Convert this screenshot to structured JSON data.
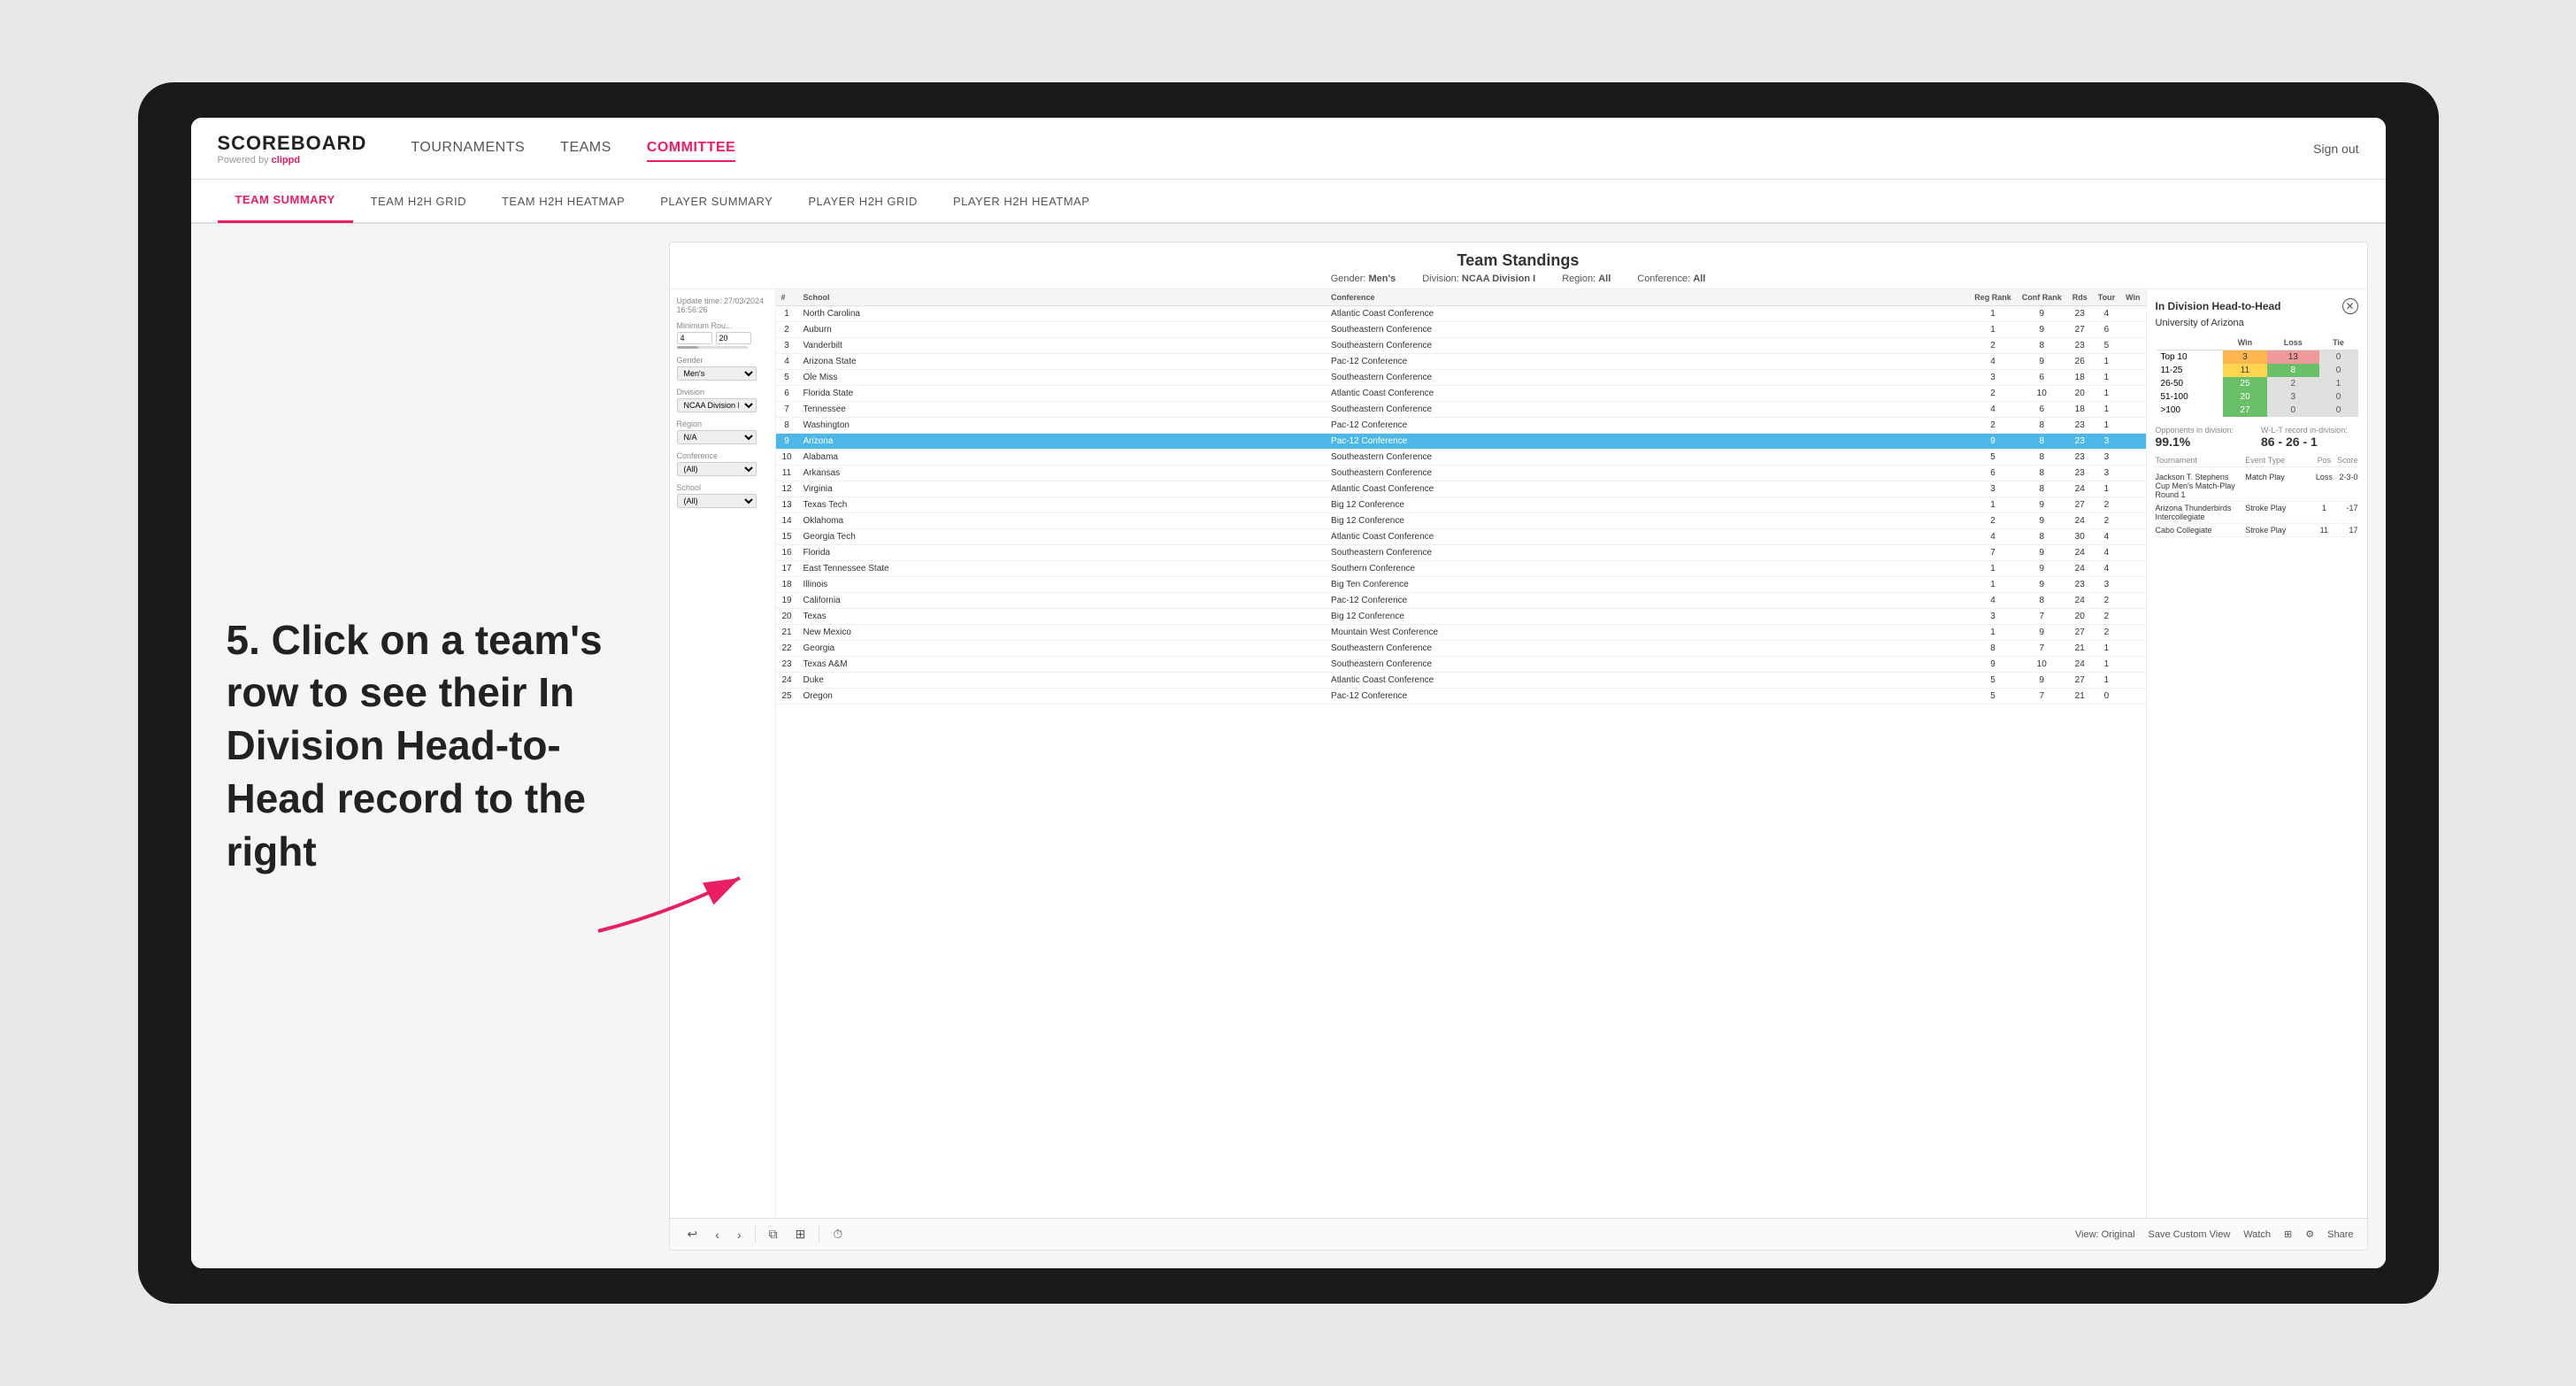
{
  "app": {
    "logo": "SCOREBOARD",
    "logo_sub": "Powered by clippd",
    "sign_out": "Sign out"
  },
  "nav": {
    "items": [
      {
        "label": "TOURNAMENTS",
        "active": false
      },
      {
        "label": "TEAMS",
        "active": false
      },
      {
        "label": "COMMITTEE",
        "active": true
      }
    ]
  },
  "sub_nav": {
    "items": [
      {
        "label": "TEAM SUMMARY",
        "active": true
      },
      {
        "label": "TEAM H2H GRID",
        "active": false
      },
      {
        "label": "TEAM H2H HEATMAP",
        "active": false
      },
      {
        "label": "PLAYER SUMMARY",
        "active": false
      },
      {
        "label": "PLAYER H2H GRID",
        "active": false
      },
      {
        "label": "PLAYER H2H HEATMAP",
        "active": false
      }
    ]
  },
  "annotation": {
    "text": "5. Click on a team's row to see their In Division Head-to-Head record to the right"
  },
  "dashboard": {
    "title": "Team Standings",
    "update_time": "Update time: 27/03/2024 16:56:26",
    "meta": {
      "gender_label": "Gender:",
      "gender_val": "Men's",
      "division_label": "Division:",
      "division_val": "NCAA Division I",
      "region_label": "Region:",
      "region_val": "All",
      "conference_label": "Conference:",
      "conference_val": "All"
    },
    "filters": {
      "min_rounds_label": "Minimum Rou...",
      "min_rounds_val1": "4",
      "min_rounds_val2": "20",
      "gender_label": "Gender",
      "gender_val": "Men's",
      "division_label": "Division",
      "division_val": "NCAA Division I",
      "region_label": "Region",
      "region_val": "N/A",
      "conference_label": "Conference",
      "conference_val": "(All)",
      "school_label": "School",
      "school_val": "(All)"
    },
    "table": {
      "headers": [
        "#",
        "School",
        "Conference",
        "Reg Rank",
        "Conf Rank",
        "Rds",
        "Tour",
        "Win"
      ],
      "rows": [
        {
          "rank": 1,
          "school": "North Carolina",
          "conference": "Atlantic Coast Conference",
          "reg_rank": 1,
          "conf_rank": 9,
          "rds": 23,
          "tour": 4
        },
        {
          "rank": 2,
          "school": "Auburn",
          "conference": "Southeastern Conference",
          "reg_rank": 1,
          "conf_rank": 9,
          "rds": 27,
          "tour": 6
        },
        {
          "rank": 3,
          "school": "Vanderbilt",
          "conference": "Southeastern Conference",
          "reg_rank": 2,
          "conf_rank": 8,
          "rds": 23,
          "tour": 5
        },
        {
          "rank": 4,
          "school": "Arizona State",
          "conference": "Pac-12 Conference",
          "reg_rank": 4,
          "conf_rank": 9,
          "rds": 26,
          "tour": 1
        },
        {
          "rank": 5,
          "school": "Ole Miss",
          "conference": "Southeastern Conference",
          "reg_rank": 3,
          "conf_rank": 6,
          "rds": 18,
          "tour": 1
        },
        {
          "rank": 6,
          "school": "Florida State",
          "conference": "Atlantic Coast Conference",
          "reg_rank": 2,
          "conf_rank": 10,
          "rds": 20,
          "tour": 1
        },
        {
          "rank": 7,
          "school": "Tennessee",
          "conference": "Southeastern Conference",
          "reg_rank": 4,
          "conf_rank": 6,
          "rds": 18,
          "tour": 1
        },
        {
          "rank": 8,
          "school": "Washington",
          "conference": "Pac-12 Conference",
          "reg_rank": 2,
          "conf_rank": 8,
          "rds": 23,
          "tour": 1
        },
        {
          "rank": 9,
          "school": "Arizona",
          "conference": "Pac-12 Conference",
          "reg_rank": 9,
          "conf_rank": 8,
          "rds": 23,
          "tour": 3,
          "highlighted": true
        },
        {
          "rank": 10,
          "school": "Alabama",
          "conference": "Southeastern Conference",
          "reg_rank": 5,
          "conf_rank": 8,
          "rds": 23,
          "tour": 3
        },
        {
          "rank": 11,
          "school": "Arkansas",
          "conference": "Southeastern Conference",
          "reg_rank": 6,
          "conf_rank": 8,
          "rds": 23,
          "tour": 3
        },
        {
          "rank": 12,
          "school": "Virginia",
          "conference": "Atlantic Coast Conference",
          "reg_rank": 3,
          "conf_rank": 8,
          "rds": 24,
          "tour": 1
        },
        {
          "rank": 13,
          "school": "Texas Tech",
          "conference": "Big 12 Conference",
          "reg_rank": 1,
          "conf_rank": 9,
          "rds": 27,
          "tour": 2
        },
        {
          "rank": 14,
          "school": "Oklahoma",
          "conference": "Big 12 Conference",
          "reg_rank": 2,
          "conf_rank": 9,
          "rds": 24,
          "tour": 2
        },
        {
          "rank": 15,
          "school": "Georgia Tech",
          "conference": "Atlantic Coast Conference",
          "reg_rank": 4,
          "conf_rank": 8,
          "rds": 30,
          "tour": 4
        },
        {
          "rank": 16,
          "school": "Florida",
          "conference": "Southeastern Conference",
          "reg_rank": 7,
          "conf_rank": 9,
          "rds": 24,
          "tour": 4
        },
        {
          "rank": 17,
          "school": "East Tennessee State",
          "conference": "Southern Conference",
          "reg_rank": 1,
          "conf_rank": 9,
          "rds": 24,
          "tour": 4
        },
        {
          "rank": 18,
          "school": "Illinois",
          "conference": "Big Ten Conference",
          "reg_rank": 1,
          "conf_rank": 9,
          "rds": 23,
          "tour": 3
        },
        {
          "rank": 19,
          "school": "California",
          "conference": "Pac-12 Conference",
          "reg_rank": 4,
          "conf_rank": 8,
          "rds": 24,
          "tour": 2
        },
        {
          "rank": 20,
          "school": "Texas",
          "conference": "Big 12 Conference",
          "reg_rank": 3,
          "conf_rank": 7,
          "rds": 20,
          "tour": 2
        },
        {
          "rank": 21,
          "school": "New Mexico",
          "conference": "Mountain West Conference",
          "reg_rank": 1,
          "conf_rank": 9,
          "rds": 27,
          "tour": 2
        },
        {
          "rank": 22,
          "school": "Georgia",
          "conference": "Southeastern Conference",
          "reg_rank": 8,
          "conf_rank": 7,
          "rds": 21,
          "tour": 1
        },
        {
          "rank": 23,
          "school": "Texas A&M",
          "conference": "Southeastern Conference",
          "reg_rank": 9,
          "conf_rank": 10,
          "rds": 24,
          "tour": 1
        },
        {
          "rank": 24,
          "school": "Duke",
          "conference": "Atlantic Coast Conference",
          "reg_rank": 5,
          "conf_rank": 9,
          "rds": 27,
          "tour": 1
        },
        {
          "rank": 25,
          "school": "Oregon",
          "conference": "Pac-12 Conference",
          "reg_rank": 5,
          "conf_rank": 7,
          "rds": 21,
          "tour": 0
        }
      ]
    },
    "h2h": {
      "title": "In Division Head-to-Head",
      "team": "University of Arizona",
      "table_headers": [
        "",
        "Win",
        "Loss",
        "Tie"
      ],
      "rows": [
        {
          "label": "Top 10",
          "win": 3,
          "loss": 13,
          "tie": 0,
          "win_color": "cell-orange",
          "loss_color": "cell-red"
        },
        {
          "label": "11-25",
          "win": 11,
          "loss": 8,
          "tie": 0,
          "win_color": "cell-yellow",
          "loss_color": "cell-green"
        },
        {
          "label": "26-50",
          "win": 25,
          "loss": 2,
          "tie": 1,
          "win_color": "cell-green",
          "loss_color": "cell-zero"
        },
        {
          "label": "51-100",
          "win": 20,
          "loss": 3,
          "tie": 0,
          "win_color": "cell-green",
          "loss_color": "cell-zero"
        },
        {
          "label": ">100",
          "win": 27,
          "loss": 0,
          "tie": 0,
          "win_color": "cell-green",
          "loss_color": "cell-zero"
        }
      ],
      "opponents_label": "Opponents in division:",
      "opponents_val": "99.1%",
      "wlt_label": "W-L-T record in-division:",
      "wlt_val": "86 - 26 - 1",
      "tournament_label": "Tournament",
      "event_type_label": "Event Type",
      "pos_label": "Pos",
      "score_label": "Score",
      "tournaments": [
        {
          "name": "Jackson T. Stephens Cup Men's Match-Play Round 1",
          "type": "Match Play",
          "result": "Loss",
          "score": "2-3-0"
        },
        {
          "name": "Arizona Thunderbirds Intercollegiate",
          "type": "Stroke Play",
          "pos": 1,
          "score": "-17"
        },
        {
          "name": "Cabo Collegiate",
          "type": "Stroke Play",
          "pos": 11,
          "score": "17"
        }
      ]
    },
    "toolbar": {
      "undo": "↩",
      "redo_left": "←",
      "redo_right": "→",
      "copy": "⧉",
      "paste": "⊞",
      "divider": "|",
      "clock": "⏱",
      "view_original": "View: Original",
      "save_custom": "Save Custom View",
      "watch": "Watch",
      "grid": "⊞",
      "settings": "⚙",
      "share": "Share"
    }
  }
}
